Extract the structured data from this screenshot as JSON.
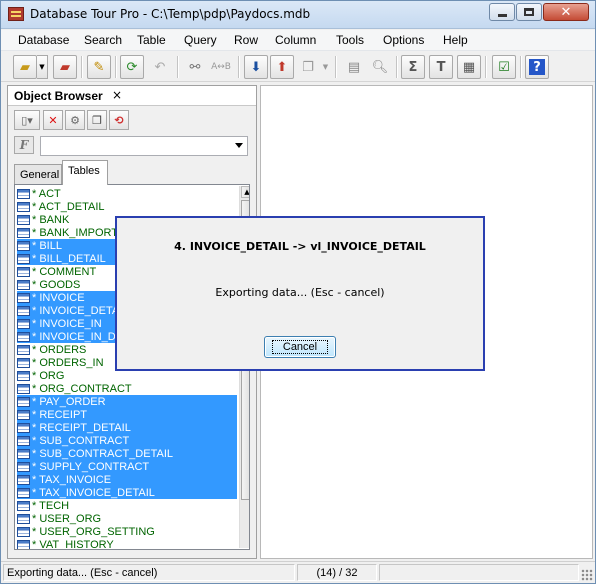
{
  "window": {
    "title": "Database Tour Pro - C:\\Temp\\pdp\\Paydocs.mdb"
  },
  "menu": [
    "Database",
    "Search",
    "Table",
    "Query",
    "Row",
    "Column",
    "Tools",
    "Options",
    "Help"
  ],
  "object_browser": {
    "title": "Object Browser",
    "close_glyph": "×",
    "filter_value": "",
    "tabs": [
      "General",
      "Tables"
    ],
    "active_tab": "Tables",
    "tables": [
      {
        "label": "* ACT",
        "selected": false
      },
      {
        "label": "* ACT_DETAIL",
        "selected": false
      },
      {
        "label": "* BANK",
        "selected": false
      },
      {
        "label": "* BANK_IMPORT",
        "selected": false
      },
      {
        "label": "* BILL",
        "selected": true
      },
      {
        "label": "* BILL_DETAIL",
        "selected": true
      },
      {
        "label": "* COMMENT",
        "selected": false
      },
      {
        "label": "* GOODS",
        "selected": false
      },
      {
        "label": "* INVOICE",
        "selected": true
      },
      {
        "label": "* INVOICE_DETAIL",
        "selected": true
      },
      {
        "label": "* INVOICE_IN",
        "selected": true
      },
      {
        "label": "* INVOICE_IN_DETAIL",
        "selected": true
      },
      {
        "label": "* ORDERS",
        "selected": false
      },
      {
        "label": "* ORDERS_IN",
        "selected": false
      },
      {
        "label": "* ORG",
        "selected": false
      },
      {
        "label": "* ORG_CONTRACT",
        "selected": false
      },
      {
        "label": "* PAY_ORDER",
        "selected": true
      },
      {
        "label": "* RECEIPT",
        "selected": true
      },
      {
        "label": "* RECEIPT_DETAIL",
        "selected": true
      },
      {
        "label": "* SUB_CONTRACT",
        "selected": true
      },
      {
        "label": "* SUB_CONTRACT_DETAIL",
        "selected": true
      },
      {
        "label": "* SUPPLY_CONTRACT",
        "selected": true
      },
      {
        "label": "* TAX_INVOICE",
        "selected": true
      },
      {
        "label": "* TAX_INVOICE_DETAIL",
        "selected": true
      },
      {
        "label": "* TECH",
        "selected": false
      },
      {
        "label": "* USER_ORG",
        "selected": false
      },
      {
        "label": "* USER_ORG_SETTING",
        "selected": false
      },
      {
        "label": "* VAT_HISTORY",
        "selected": false
      }
    ]
  },
  "dialog": {
    "title": "4. INVOICE_DETAIL -> vl_INVOICE_DETAIL",
    "message": "Exporting data... (Esc - cancel)",
    "cancel_label": "Cancel"
  },
  "statusbar": {
    "message": "Exporting data... (Esc - cancel)",
    "counter": "(14) / 32"
  },
  "colors": {
    "selection": "#3399ff",
    "table_name": "#006400",
    "dialog_border": "#2a3fb0"
  }
}
